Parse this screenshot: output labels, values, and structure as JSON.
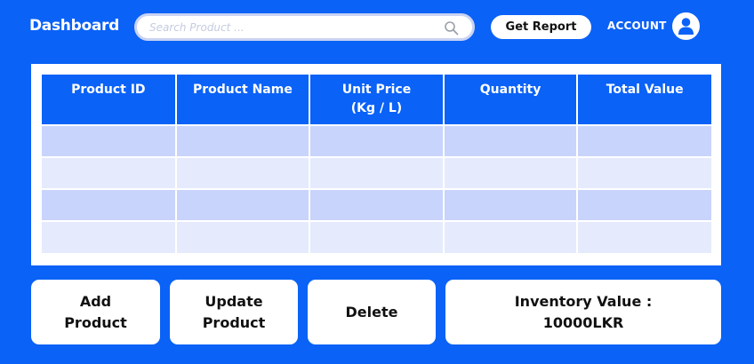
{
  "header": {
    "title": "Dashboard",
    "search_placeholder": "Search Product ...",
    "report_label": "Get Report",
    "account_label": "ACCOUNT"
  },
  "table": {
    "columns": [
      {
        "label": "Product ID"
      },
      {
        "label": "Product Name"
      },
      {
        "label": "Unit Price\n(Kg / L)"
      },
      {
        "label": "Quantity"
      },
      {
        "label": "Total Value"
      }
    ],
    "row_count": 4
  },
  "actions": {
    "add_label": "Add\nProduct",
    "update_label": "Update\nProduct",
    "delete_label": "Delete"
  },
  "inventory": {
    "label": "Inventory Value :",
    "value": "10000LKR"
  },
  "colors": {
    "background": "#0a62f7",
    "header_row": "#0a62f7",
    "row_odd": "#c8d4fb",
    "row_even": "#e5ebfd"
  },
  "icons": {
    "search": "search-icon",
    "account": "user-icon"
  }
}
